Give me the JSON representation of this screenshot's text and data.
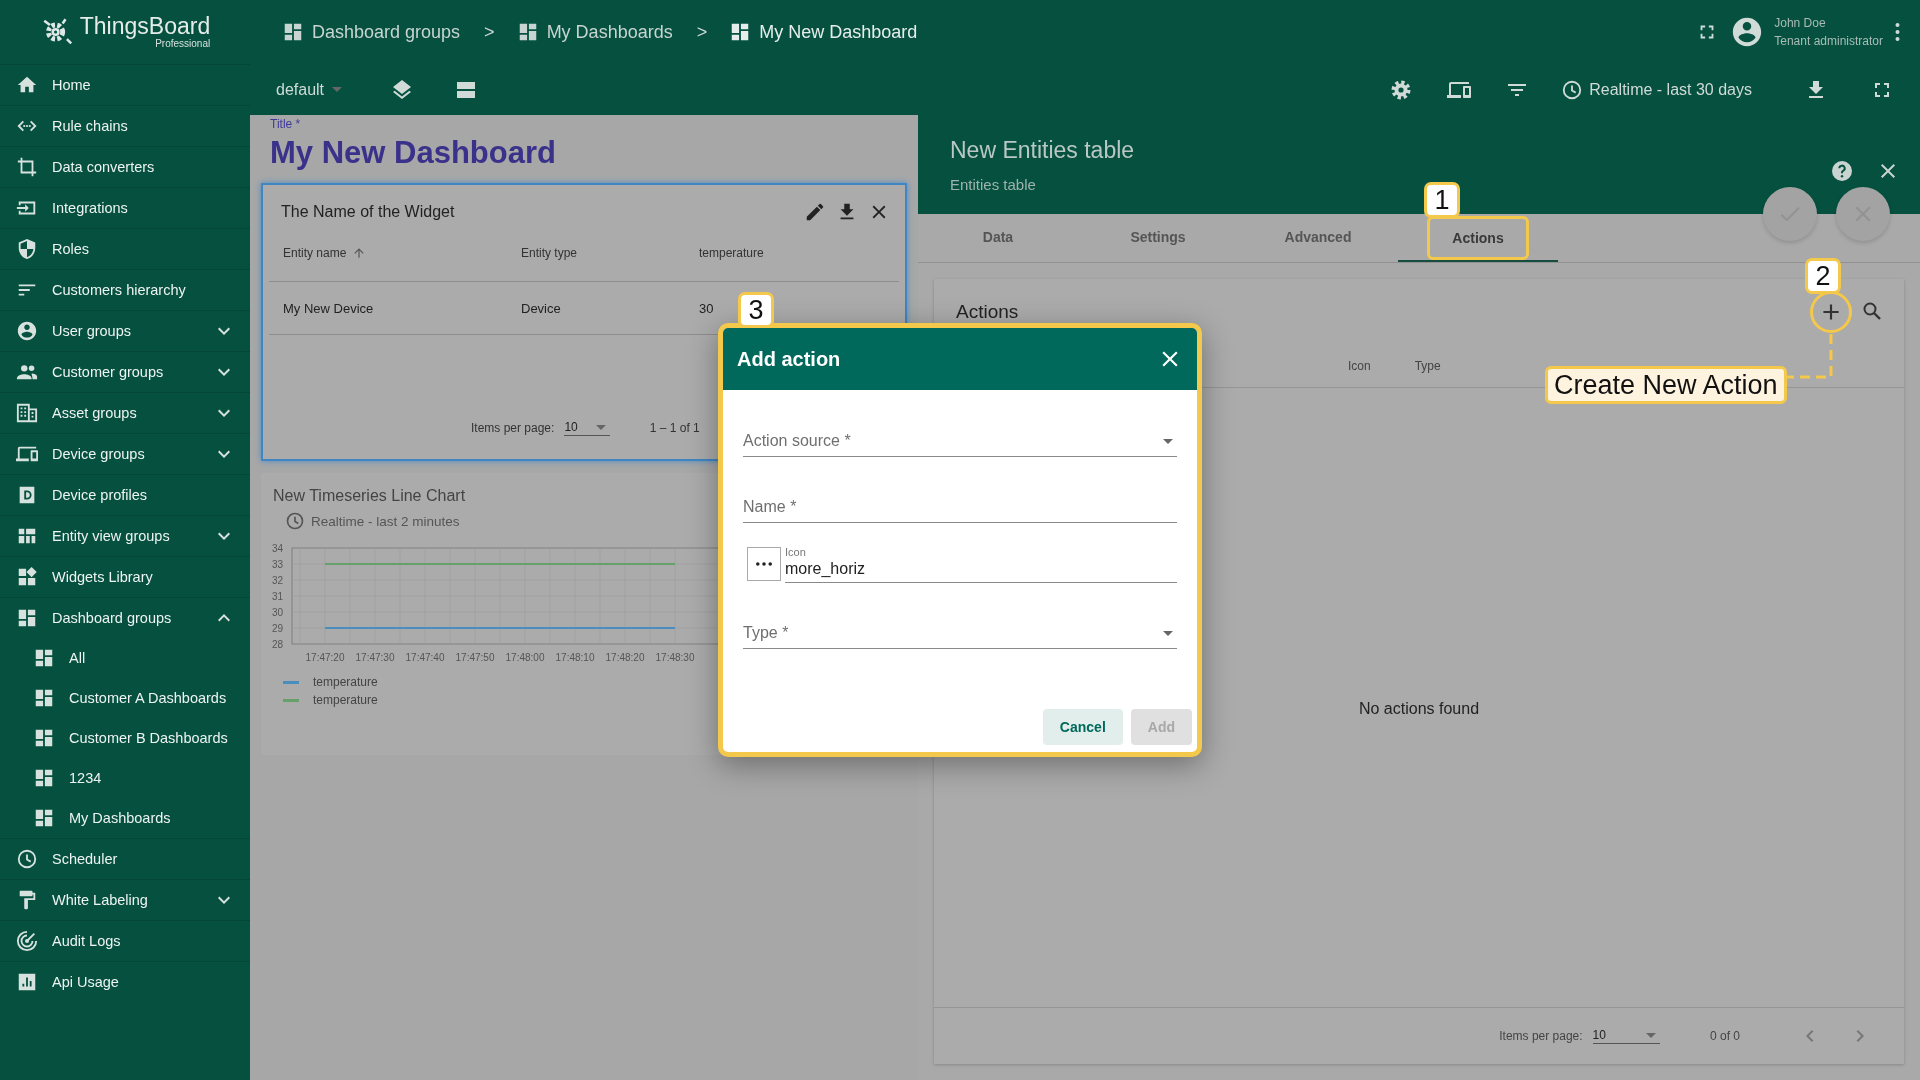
{
  "logo": {
    "name": "ThingsBoard",
    "edition": "Professional"
  },
  "sidebar": {
    "items": [
      {
        "label": "Home"
      },
      {
        "label": "Rule chains"
      },
      {
        "label": "Data converters"
      },
      {
        "label": "Integrations"
      },
      {
        "label": "Roles"
      },
      {
        "label": "Customers hierarchy"
      },
      {
        "label": "User groups",
        "expanded": false
      },
      {
        "label": "Customer groups",
        "expanded": false
      },
      {
        "label": "Asset groups",
        "expanded": false
      },
      {
        "label": "Device groups",
        "expanded": false
      },
      {
        "label": "Device profiles"
      },
      {
        "label": "Entity view groups",
        "expanded": false
      },
      {
        "label": "Widgets Library"
      },
      {
        "label": "Dashboard groups",
        "expanded": true,
        "children": [
          {
            "label": "All"
          },
          {
            "label": "Customer A Dashboards"
          },
          {
            "label": "Customer B Dashboards"
          },
          {
            "label": "1234"
          },
          {
            "label": "My Dashboards"
          }
        ]
      },
      {
        "label": "Scheduler"
      },
      {
        "label": "White Labeling",
        "expanded": false
      },
      {
        "label": "Audit Logs"
      },
      {
        "label": "Api Usage"
      }
    ]
  },
  "breadcrumbs": [
    {
      "label": "Dashboard groups"
    },
    {
      "separator": ">",
      "label": "My Dashboards"
    },
    {
      "separator": ">",
      "label": "My New Dashboard"
    }
  ],
  "user": {
    "name": "John Doe",
    "role": "Tenant administrator"
  },
  "toolbar": {
    "layout": "default",
    "timewindow": "Realtime - last 30 days"
  },
  "dashboard": {
    "title_label": "Title *",
    "title": "My New Dashboard"
  },
  "table_widget": {
    "title": "The Name of the Widget",
    "columns": [
      {
        "label": "Entity name",
        "sorted": true
      },
      {
        "label": "Entity type",
        "sorted": false
      },
      {
        "label": "temperature",
        "sorted": false
      }
    ],
    "rows": [
      [
        "My New Device",
        "Device",
        "30"
      ]
    ],
    "paginator": {
      "label": "Items per page:",
      "page_size": "10",
      "range": "1 – 1 of 1"
    }
  },
  "chart_widget": {
    "title": "New Timeseries Line Chart",
    "timewindow": "Realtime - last 2 minutes",
    "chart_data": {
      "type": "line",
      "categories": [
        "17:47:20",
        "17:47:30",
        "17:47:40",
        "17:47:50",
        "17:48:00",
        "17:48:10",
        "17:48:20",
        "17:48:30"
      ],
      "ylim": [
        28,
        34
      ],
      "yticks": [
        28,
        29,
        30,
        31,
        32,
        33,
        34
      ],
      "series": [
        {
          "name": "temperature",
          "color": "#4a8dbf",
          "values": [
            29,
            29,
            29,
            29,
            29,
            29,
            29,
            29
          ]
        },
        {
          "name": "temperature",
          "color": "#66a06a",
          "values": [
            33,
            33,
            33,
            33,
            33,
            33,
            33,
            33
          ]
        }
      ]
    }
  },
  "widget_editor": {
    "title": "New Entities table",
    "subtitle": "Entities table",
    "tabs": [
      {
        "label": "Data",
        "selected": false
      },
      {
        "label": "Settings",
        "selected": false
      },
      {
        "label": "Advanced",
        "selected": false
      },
      {
        "label": "Actions",
        "selected": true
      }
    ],
    "actions_panel": {
      "title": "Actions",
      "columns": [
        "Icon",
        "Type"
      ],
      "empty_text": "No actions found",
      "paginator": {
        "label": "Items per page:",
        "page_size": "10",
        "range": "0 of 0"
      }
    }
  },
  "dialog": {
    "title": "Add action",
    "action_source": {
      "placeholder": "Action source *"
    },
    "name": {
      "placeholder": "Name *"
    },
    "icon": {
      "label": "Icon",
      "value": "more_horiz"
    },
    "type": {
      "placeholder": "Type *"
    },
    "buttons": [
      {
        "label": "Cancel",
        "kind": "secondary",
        "disabled": false
      },
      {
        "label": "Add",
        "kind": "primary",
        "disabled": true
      }
    ]
  },
  "annotations": {
    "badges": [
      "1",
      "2",
      "3"
    ],
    "callout": "Create New Action"
  }
}
